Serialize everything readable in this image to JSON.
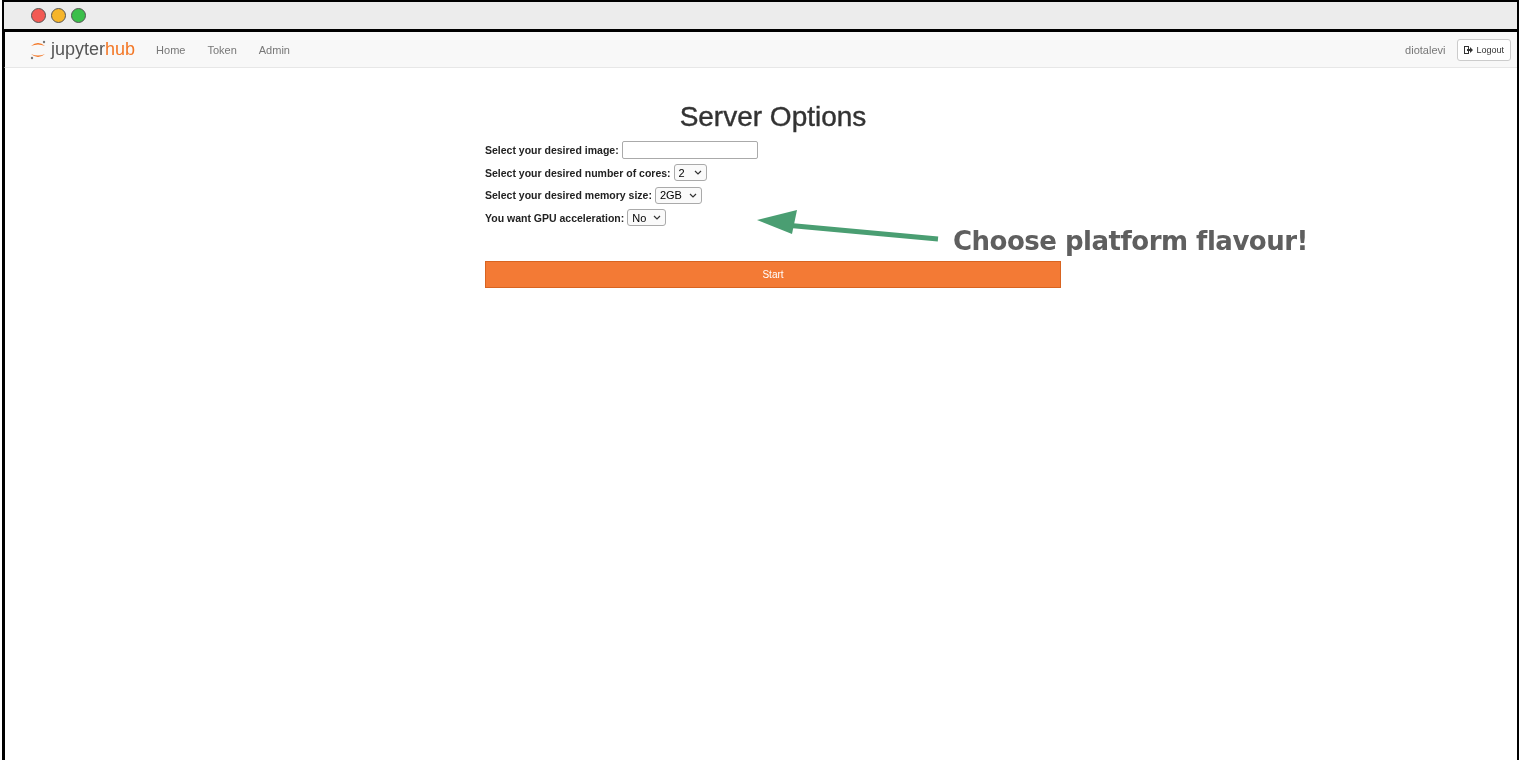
{
  "navbar": {
    "logo": {
      "prefix": "jupyter",
      "suffix": "hub"
    },
    "links": [
      "Home",
      "Token",
      "Admin"
    ],
    "user": "diotalevi",
    "logout": "Logout"
  },
  "page": {
    "title": "Server Options",
    "fields": [
      {
        "kind": "input",
        "label": "Select your desired image:"
      },
      {
        "kind": "select",
        "label": "Select your desired number of cores:",
        "value": "2"
      },
      {
        "kind": "select",
        "label": "Select your desired memory size:",
        "value": "2GB"
      },
      {
        "kind": "select",
        "label": "You want GPU acceleration:",
        "value": "No"
      }
    ],
    "start_button": "Start"
  },
  "annotation": "Choose platform flavour!"
}
